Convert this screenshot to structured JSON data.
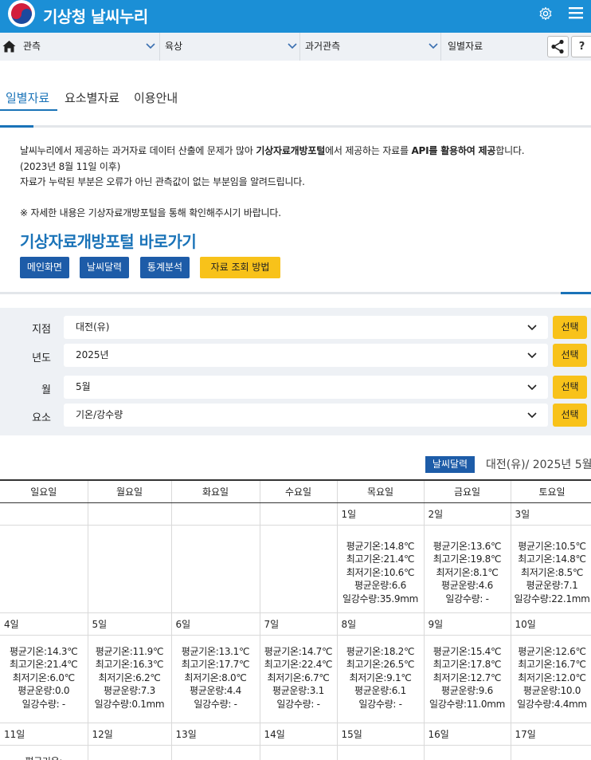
{
  "header": {
    "app_title": "기상청 날씨누리",
    "brand_color": "#1b8fd6",
    "icons": [
      "taegeuk-logo-icon",
      "gear-icon",
      "menu-icon"
    ]
  },
  "breadcrumb": {
    "items": [
      "관측",
      "육상",
      "과거관측",
      "일별자료"
    ],
    "help_label": "?"
  },
  "tabs": [
    {
      "label": "일별자료",
      "active": true
    },
    {
      "label": "요소별자료",
      "active": false
    },
    {
      "label": "이용안내",
      "active": false
    }
  ],
  "notice": {
    "line1_a": "날씨누리에서 제공하는 과거자료 데이터 산출에 문제가 많아 ",
    "line1_b": "기상자료개방포털",
    "line1_c": "에서 제공하는 자료를 ",
    "line1_d": "API를 활용하여 제공",
    "line1_e": "합니다.",
    "line2": "(2023년 8월 11일 이후)",
    "line3": "자료가 누락된 부분은 오류가 아닌 관측값이 없는 부분임을 알려드립니다.",
    "line4": "※ 자세한 내용은 기상자료개방포털을 통해 확인해주시기 바랍니다.",
    "portal_link": "기상자료개방포털 바로가기",
    "buttons": [
      "메인화면",
      "날씨달력",
      "통계분석"
    ],
    "guide_button": "자료 조회 방법"
  },
  "form": {
    "rows": [
      {
        "label": "지점",
        "value": "대전(유)",
        "button": "선택"
      },
      {
        "label": "년도",
        "value": "2025년",
        "button": "선택"
      },
      {
        "label": "월",
        "value": "5월",
        "button": "선택"
      },
      {
        "label": "요소",
        "value": "기온/강수량",
        "button": "선택"
      }
    ]
  },
  "calendar": {
    "badge": "날씨달력",
    "title": "대전(유)/ 2025년 5월",
    "weekdays": [
      "일요일",
      "월요일",
      "화요일",
      "수요일",
      "목요일",
      "금요일",
      "토요일"
    ],
    "weeks": [
      {
        "dates": [
          "",
          "",
          "",
          "",
          "1일",
          "2일",
          "3일"
        ],
        "cells": [
          [],
          [],
          [],
          [],
          [
            "평균기온:14.8℃",
            "최고기온:21.4℃",
            "최저기온:10.6℃",
            "평균운량:6.6",
            "일강수량:35.9mm"
          ],
          [
            "평균기온:13.6℃",
            "최고기온:19.8℃",
            "최저기온:8.1℃",
            "평균운량:4.6",
            "일강수량: -"
          ],
          [
            "평균기온:10.5℃",
            "최고기온:14.8℃",
            "최저기온:8.5℃",
            "평균운량:7.1",
            "일강수량:22.1mm"
          ]
        ]
      },
      {
        "dates": [
          "4일",
          "5일",
          "6일",
          "7일",
          "8일",
          "9일",
          "10일"
        ],
        "cells": [
          [
            "평균기온:14.3℃",
            "최고기온:21.4℃",
            "최저기온:6.0℃",
            "평균운량:0.0",
            "일강수량: -"
          ],
          [
            "평균기온:11.9℃",
            "최고기온:16.3℃",
            "최저기온:6.2℃",
            "평균운량:7.3",
            "일강수량:0.1mm"
          ],
          [
            "평균기온:13.1℃",
            "최고기온:17.7℃",
            "최저기온:8.0℃",
            "평균운량:4.4",
            "일강수량: -"
          ],
          [
            "평균기온:14.7℃",
            "최고기온:22.4℃",
            "최저기온:6.7℃",
            "평균운량:3.1",
            "일강수량: -"
          ],
          [
            "평균기온:18.2℃",
            "최고기온:26.5℃",
            "최저기온:9.1℃",
            "평균운량:6.1",
            "일강수량: -"
          ],
          [
            "평균기온:15.4℃",
            "최고기온:17.8℃",
            "최저기온:12.7℃",
            "평균운량:9.6",
            "일강수량:11.0mm"
          ],
          [
            "평균기온:12.6℃",
            "최고기온:16.7℃",
            "최저기온:12.0℃",
            "평균운량:10.0",
            "일강수량:4.4mm"
          ]
        ]
      },
      {
        "dates": [
          "11일",
          "12일",
          "13일",
          "14일",
          "15일",
          "16일",
          "17일"
        ],
        "cells": [
          [
            "평균기온:"
          ],
          [],
          [],
          [],
          [],
          [],
          []
        ]
      }
    ]
  }
}
